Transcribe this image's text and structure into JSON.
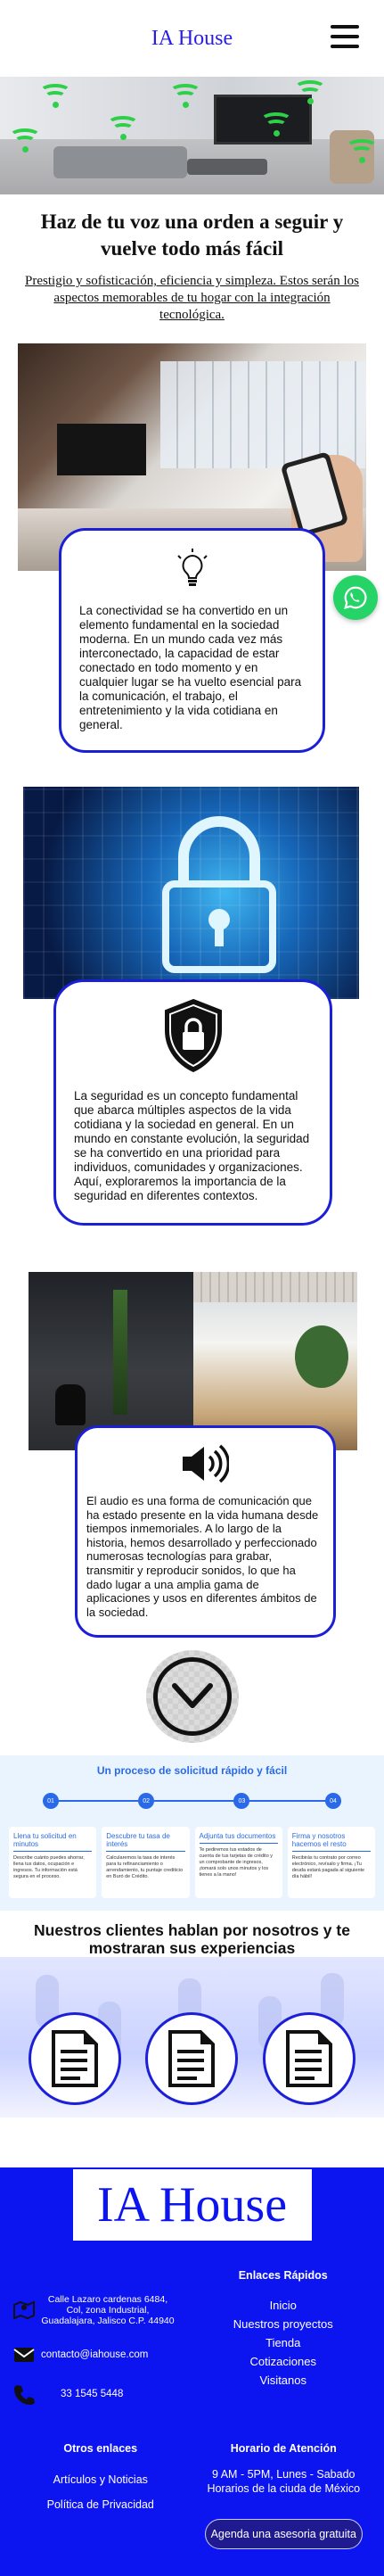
{
  "header": {
    "brand": "IA House"
  },
  "hero": {
    "headline": "Haz de tu voz una orden a seguir y vuelve todo más fácil",
    "subline": "Prestigio y sofisticación, eficiencia y simpleza. Estos serán los aspectos memorables de tu hogar con la integración tecnológica."
  },
  "features": [
    {
      "icon": "lightbulb-icon",
      "text": "La conectividad se ha convertido en un elemento fundamental en la sociedad moderna. En un mundo cada vez más interconectado, la capacidad de estar conectado en todo momento y en cualquier lugar se ha vuelto esencial para la comunicación, el trabajo, el entretenimiento y la vida cotidiana en general."
    },
    {
      "icon": "lock-shield-icon",
      "text": "La seguridad es un concepto fundamental que abarca múltiples aspectos de la vida cotidiana y la sociedad en general. En un mundo en constante evolución, la seguridad se ha convertido en una prioridad para individuos, comunidades y organizaciones. Aquí, exploraremos la importancia de la seguridad en diferentes contextos."
    },
    {
      "icon": "speaker-icon",
      "text": "El audio es una forma de comunicación que ha estado presente en la vida humana desde tiempos inmemoriales. A lo largo de la historia, hemos desarrollado y perfeccionado numerosas tecnologías para grabar, transmitir y reproducir sonidos, lo que ha dado lugar a una amplia gama de aplicaciones y usos en diferentes ámbitos de la sociedad."
    }
  ],
  "process": {
    "title": "Un proceso de solicitud rápido y fácil",
    "steps": [
      {
        "number": "01",
        "title": "Llena tu solicitud en minutos",
        "text": "Describe cuánto puedes ahorrar, llena tus datos, ocupación e ingresos. Tu información está segura en el proceso."
      },
      {
        "number": "02",
        "title": "Descubre tu tasa de interés",
        "text": "Calcularemos la tasa de interés para tu refinanciamiento o arrendamiento, tu puntaje crediticio en Buró de Crédito."
      },
      {
        "number": "03",
        "title": "Adjunta tus documentos",
        "text": "Te pediremos tus estados de cuenta de tus tarjetas de crédito y un comprobante de ingresos, ¡tomará solo unos minutos y los tienes a la mano!"
      },
      {
        "number": "04",
        "title": "Firma y nosotros hacemos el resto",
        "text": "Recibirás tu contrato por correo electrónico, revísalo y firma. ¡Tu deuda estará pagada al siguiente día hábil!"
      }
    ]
  },
  "testimonials": {
    "title": "Nuestros clientes hablan por nosotros y te mostraran sus experiencias"
  },
  "footer": {
    "logo": "IA House",
    "address": "Calle Lazaro cardenas 6484, Col, zona Industrial, Guadalajara, Jalisco C.P. 44940",
    "email": "contacto@iahouse.com",
    "phone": "33 1545 5448",
    "quick_links_title": "Enlaces Rápidos",
    "quick_links": [
      "Inicio",
      "Nuestros proyectos",
      "Tienda",
      "Cotizaciones",
      "Visitanos"
    ],
    "other_links_title": "Otros enlaces",
    "other_links": [
      "Artículos y Noticias",
      "Política de Privacidad"
    ],
    "hours_title": "Horario de Atención",
    "hours_text": "9 AM - 5PM, Lunes - Sabado Horarios de la ciuda de México",
    "cta": "Agenda una asesoria gratuita"
  },
  "colors": {
    "accent": "#1b20d8",
    "footer_bg": "#0c14ef",
    "whatsapp": "#25d366",
    "process_blue": "#2a6ae8"
  }
}
